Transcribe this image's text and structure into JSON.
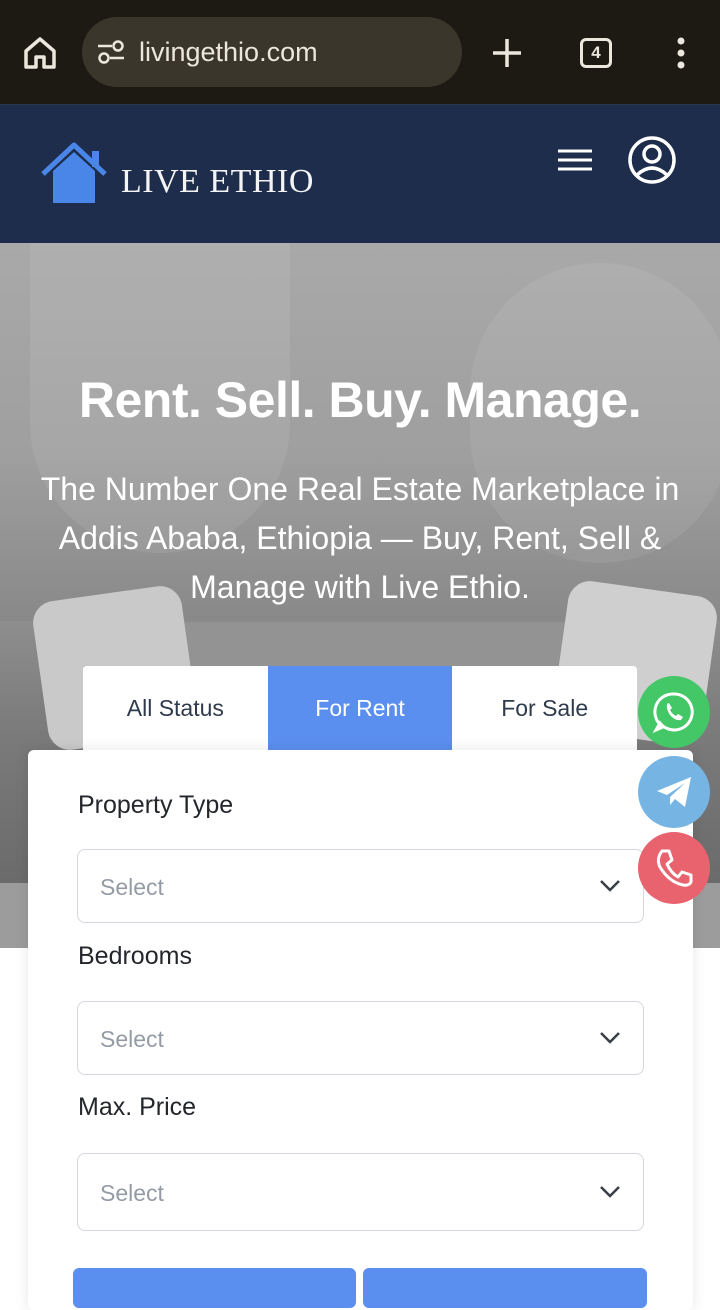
{
  "browser": {
    "url": "livingethio.com",
    "tab_count": "4",
    "icons": [
      "home-icon",
      "site-settings-icon",
      "new-tab-icon",
      "tabs-icon",
      "more-vert-icon"
    ]
  },
  "header": {
    "brand": "LIVE ETHIO",
    "icons": [
      "house-logo-icon",
      "hamburger-menu-icon",
      "account-circle-icon"
    ],
    "bg_color": "#1d2d4b",
    "logo_color": "#4a86e8"
  },
  "hero": {
    "title": "Rent. Sell. Buy. Manage.",
    "subtitle": "The Number One Real Estate Marketplace in Addis Ababa, Ethiopia — Buy, Rent, Sell & Manage with Live Ethio."
  },
  "search": {
    "tabs": [
      {
        "label": "All Status",
        "active": false
      },
      {
        "label": "For Rent",
        "active": true
      },
      {
        "label": "For Sale",
        "active": false
      }
    ],
    "fields": [
      {
        "label": "Property Type",
        "value": "Select"
      },
      {
        "label": "Bedrooms",
        "value": "Select"
      },
      {
        "label": "Max. Price",
        "value": "Select"
      }
    ],
    "accent_color": "#5b8fef"
  },
  "floating_contacts": [
    {
      "name": "whatsapp",
      "color": "#44c767"
    },
    {
      "name": "telegram",
      "color": "#76b4e4"
    },
    {
      "name": "phone",
      "color": "#e9636f"
    }
  ]
}
